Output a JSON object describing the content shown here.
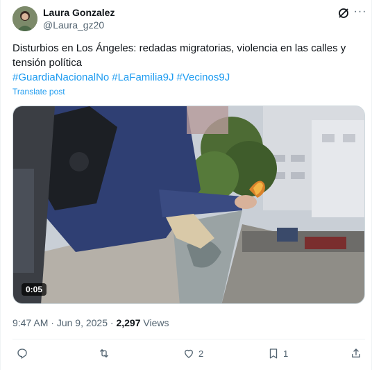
{
  "author": {
    "name": "Laura Gonzalez",
    "handle": "@Laura_gz20"
  },
  "post": {
    "text": "Disturbios en Los Ángeles: redadas migratorias, violencia en las calles y tensión política",
    "hashtags": [
      "#GuardiaNacionalNo",
      "#LaFamilia9J",
      "#Vecinos9J"
    ],
    "translate_label": "Translate post"
  },
  "media": {
    "type": "video",
    "duration": "0:05"
  },
  "meta": {
    "time": "9:47 AM",
    "separator": "·",
    "date": "Jun 9, 2025",
    "views_count": "2,297",
    "views_label": "Views"
  },
  "actions": {
    "reply_count": "",
    "repost_count": "",
    "like_count": "2",
    "bookmark_count": "1"
  },
  "icons": [
    "grok-icon",
    "more-icon",
    "reply-icon",
    "repost-icon",
    "like-icon",
    "bookmark-icon",
    "share-icon"
  ],
  "colors": {
    "link": "#1d9bf0",
    "secondary_text": "#536471",
    "primary_text": "#0f1419"
  }
}
